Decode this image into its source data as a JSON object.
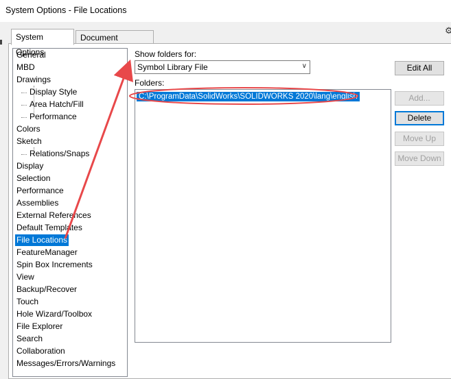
{
  "window": {
    "title": "System Options - File Locations"
  },
  "tabs": [
    {
      "label": "System Options",
      "active": true
    },
    {
      "label": "Document Properties",
      "active": false
    }
  ],
  "tree": {
    "items": [
      {
        "label": "General",
        "level": 0
      },
      {
        "label": "MBD",
        "level": 0
      },
      {
        "label": "Drawings",
        "level": 0
      },
      {
        "label": "Display Style",
        "level": 1
      },
      {
        "label": "Area Hatch/Fill",
        "level": 1
      },
      {
        "label": "Performance",
        "level": 1
      },
      {
        "label": "Colors",
        "level": 0
      },
      {
        "label": "Sketch",
        "level": 0
      },
      {
        "label": "Relations/Snaps",
        "level": 1
      },
      {
        "label": "Display",
        "level": 0
      },
      {
        "label": "Selection",
        "level": 0
      },
      {
        "label": "Performance",
        "level": 0
      },
      {
        "label": "Assemblies",
        "level": 0
      },
      {
        "label": "External References",
        "level": 0
      },
      {
        "label": "Default Templates",
        "level": 0
      },
      {
        "label": "File Locations",
        "level": 0,
        "selected": true
      },
      {
        "label": "FeatureManager",
        "level": 0
      },
      {
        "label": "Spin Box Increments",
        "level": 0
      },
      {
        "label": "View",
        "level": 0
      },
      {
        "label": "Backup/Recover",
        "level": 0
      },
      {
        "label": "Touch",
        "level": 0
      },
      {
        "label": "Hole Wizard/Toolbox",
        "level": 0
      },
      {
        "label": "File Explorer",
        "level": 0
      },
      {
        "label": "Search",
        "level": 0
      },
      {
        "label": "Collaboration",
        "level": 0
      },
      {
        "label": "Messages/Errors/Warnings",
        "level": 0
      }
    ]
  },
  "main": {
    "show_folders_label": "Show folders for:",
    "show_folders_value": "Symbol Library File",
    "folders_label": "Folders:",
    "folders": [
      "C:\\ProgramData\\SolidWorks\\SOLIDWORKS 2020\\lang\\english"
    ]
  },
  "buttons": {
    "edit_all": "Edit All",
    "add": "Add...",
    "delete": "Delete",
    "move_up": "Move Up",
    "move_down": "Move Down"
  },
  "colors": {
    "selection": "#0078d7",
    "annotation": "#e8484a"
  }
}
